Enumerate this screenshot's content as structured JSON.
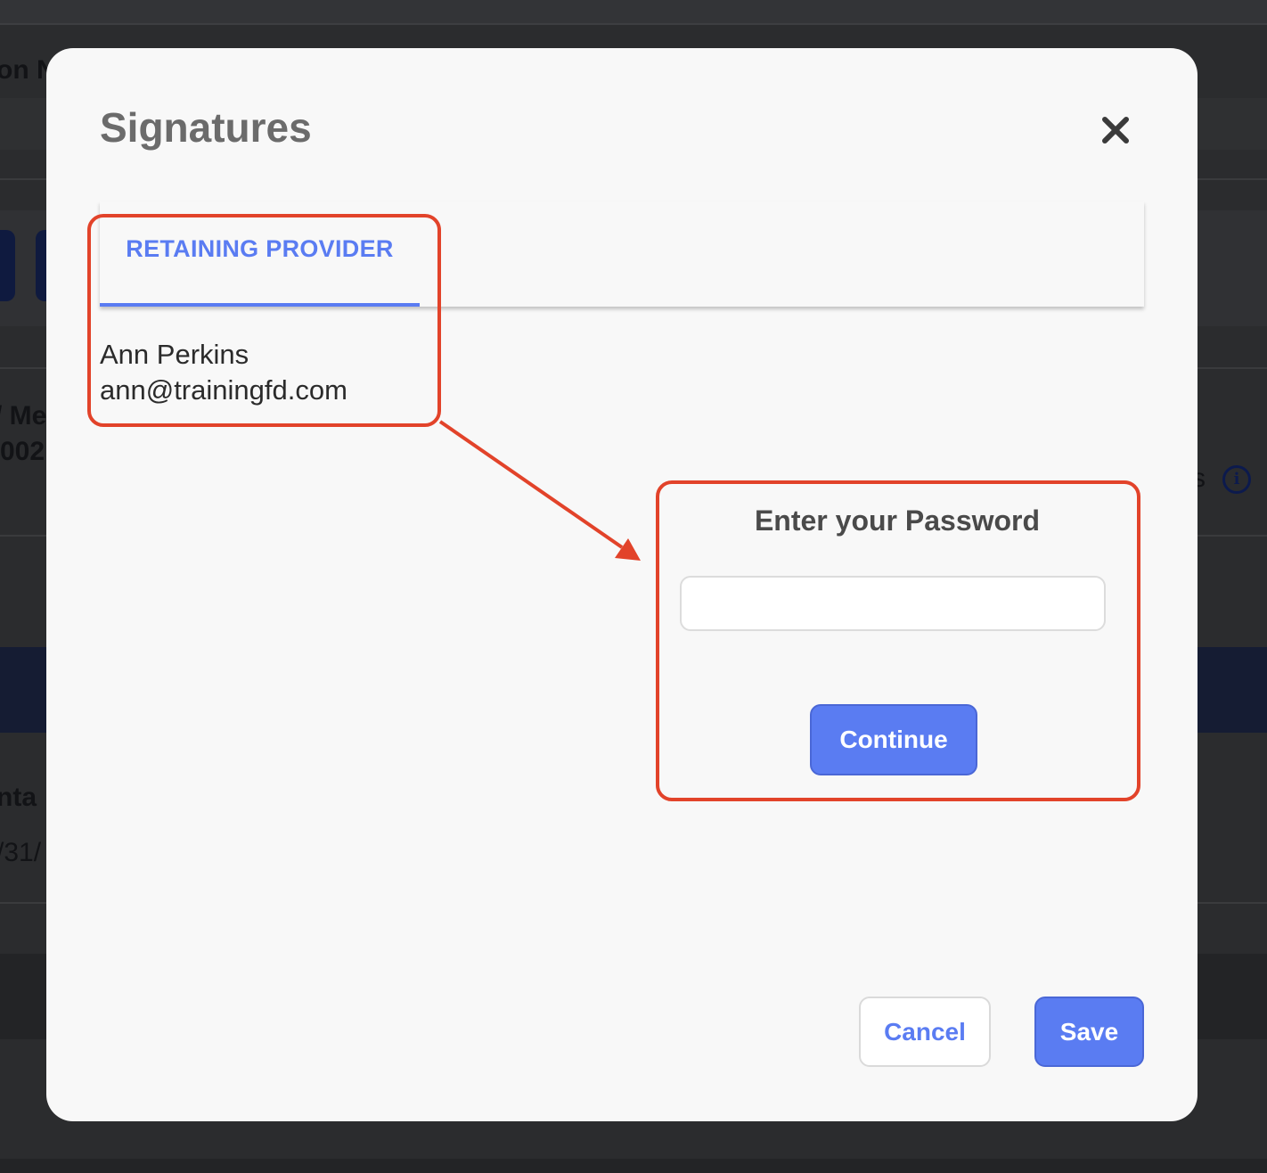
{
  "background": {
    "fragments": [
      "on N",
      "/ Me",
      "002",
      "nta",
      "/31/",
      "s"
    ]
  },
  "modal": {
    "title": "Signatures",
    "close_icon": "close-icon",
    "tab": {
      "label": "RETAINING PROVIDER",
      "active": true
    },
    "provider": {
      "name": "Ann Perkins",
      "email": "ann@trainingfd.com"
    },
    "password": {
      "label": "Enter your Password",
      "value": "",
      "placeholder": ""
    },
    "continue_label": "Continue",
    "cancel_label": "Cancel",
    "save_label": "Save"
  },
  "colors": {
    "accent": "#5a7cf2",
    "annotation": "#e2432a",
    "overlay": "#2b2c2e"
  }
}
